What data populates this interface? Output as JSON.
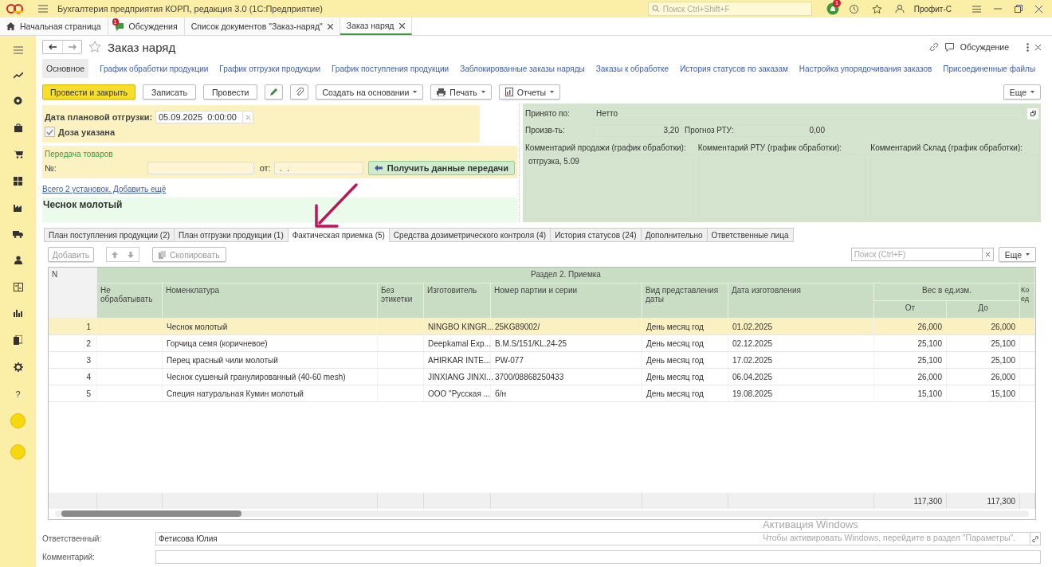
{
  "app": {
    "title": "Бухгалтерия предприятия КОРП, редакция 3.0  (1С:Предприятие)",
    "search_placeholder": "Поиск Ctrl+Shift+F",
    "notification_count": "1",
    "user": "Профит-С"
  },
  "open_tabs": [
    {
      "label": "Начальная страница",
      "kind": "home",
      "selected": false,
      "closable": false
    },
    {
      "label": "Обсуждения",
      "kind": "discussions",
      "badge": "1",
      "selected": false,
      "closable": false
    },
    {
      "label": "Список документов \"Заказ-наряд\"",
      "kind": "document",
      "selected": false,
      "closable": true
    },
    {
      "label": "Заказ наряд",
      "kind": "document",
      "selected": true,
      "closable": true
    }
  ],
  "sidebar": {
    "help": "?"
  },
  "form": {
    "title": "Заказ наряд",
    "discussion": "Обсуждение"
  },
  "sections": [
    {
      "label": "Основное",
      "selected": true
    },
    {
      "label": "График обработки продукции",
      "selected": false
    },
    {
      "label": "График отгрузки продукции",
      "selected": false
    },
    {
      "label": "График поступления продукции",
      "selected": false
    },
    {
      "label": "Заблокированные заказы наряды",
      "selected": false
    },
    {
      "label": "Заказы к обработке",
      "selected": false
    },
    {
      "label": "История статусов по заказам",
      "selected": false
    },
    {
      "label": "Настройка упорядочивания заказов",
      "selected": false
    },
    {
      "label": "Присоединенные файлы",
      "selected": false
    }
  ],
  "toolbar": [
    {
      "kind": "primary",
      "label": "Провести и закрыть"
    },
    {
      "kind": "plain",
      "label": "Записать"
    },
    {
      "kind": "plain",
      "label": "Провести"
    },
    {
      "kind": "icon"
    },
    {
      "kind": "icon"
    },
    {
      "kind": "menu",
      "label": "Создать на основании"
    },
    {
      "kind": "menu",
      "label": "Печать"
    },
    {
      "kind": "menu",
      "label": "Отчеты"
    }
  ],
  "more": "Еще",
  "shipment": {
    "label": "Дата плановой отгрузки:",
    "value": "05.09.2025  0:00:00",
    "dose_label": "Доза указана",
    "dose_checked": true
  },
  "transfer": {
    "title": "Передача товаров",
    "number_label": "№:",
    "from_label": "от:",
    "from_value": " .  .",
    "button": "Получить данные передачи"
  },
  "settings_link": "Всего 2 установок. Добавить ещё",
  "product": "Чеснок молотый",
  "info": {
    "accepted_label": "Принято по:",
    "accepted_value": "Нетто",
    "productivity_label": "Произв-ть:",
    "productivity_value": "3,20",
    "forecast_label": "Прогноз РТУ:",
    "forecast_value": "0,00",
    "comments": [
      {
        "label": "Комментарий продажи (график обработки):",
        "value": "отгрузка, 5.09"
      },
      {
        "label": "Комментарий РТУ (график обработки):"
      },
      {
        "label": "Комментарий Склад (график обработки):"
      }
    ]
  },
  "tabs": [
    {
      "label": "План поступления продукции (2)",
      "selected": false
    },
    {
      "label": "План отгрузки продукции (1)",
      "selected": false
    },
    {
      "label": "Фактическая приемка (5)",
      "selected": true
    },
    {
      "label": "Средства дозиметрического контроля (4)",
      "selected": false
    },
    {
      "label": "История статусов (24)",
      "selected": false
    },
    {
      "label": "Дополнительно",
      "selected": false
    },
    {
      "label": "Ответственные лица",
      "selected": false
    }
  ],
  "table_toolbar": {
    "add": "Добавить",
    "copy": "Скопировать",
    "search_placeholder": "Поиск (Ctrl+F)",
    "more": "Еще"
  },
  "table": {
    "n_header": "N",
    "group_header": "Раздел 2. Приемка",
    "columns": [
      "Не обрабатывать",
      "Номенклатура",
      "Без этикетки",
      "Изготовитель",
      "Номер партии и серии",
      "Вид представления даты",
      "Дата изготовления"
    ],
    "weight_header": "Вес в ед.изм.",
    "weight_columns": [
      "От",
      "До"
    ],
    "column_12": "Ко ед",
    "rows": [
      {
        "n": "1",
        "selected": true,
        "name": "Чеснок молотый",
        "maker": "NINGBO KINGR...",
        "batch": "25KG89002/",
        "date_kind": "День месяц год",
        "date": "01.02.2025",
        "from": "26,000",
        "to": "26,000"
      },
      {
        "n": "2",
        "selected": false,
        "name": "Горчица семя (коричневое)",
        "maker": "Deepkamal Exp...",
        "batch": "B.M.S/151/KL.24-25",
        "date_kind": "День месяц год",
        "date": "02.12.2025",
        "from": "25,100",
        "to": "25,100"
      },
      {
        "n": "3",
        "selected": false,
        "name": "Перец красный чили молотый",
        "maker": "AHIRKAR INTE...",
        "batch": "PW-077",
        "date_kind": "День месяц год",
        "date": "17.02.2025",
        "from": "25,100",
        "to": "25,100"
      },
      {
        "n": "4",
        "selected": false,
        "name": "Чеснок сушеный гранулированный (40-60 mesh)",
        "maker": "JINXIANG JINXI...",
        "batch": "3700/08868250433",
        "date_kind": "День месяц год",
        "date": "06.04.2025",
        "from": "26,000",
        "to": "26,000"
      },
      {
        "n": "5",
        "selected": false,
        "name": "Специя натуральная Кумин молотый",
        "maker": "ООО \"Русская ...",
        "batch": "б/н",
        "date_kind": "День месяц год",
        "date": "19.08.2025",
        "from": "15,100",
        "to": "15,100"
      }
    ],
    "totals": {
      "from": "117,300",
      "to": "117,300"
    }
  },
  "footer": {
    "responsible_label": "Ответственный:",
    "responsible_value": "Фетисова Юлия",
    "comment_label": "Комментарий:"
  },
  "windows_activation": {
    "title": "Активация Windows",
    "text": "Чтобы активировать Windows, перейдите в раздел \"Параметры\"."
  }
}
